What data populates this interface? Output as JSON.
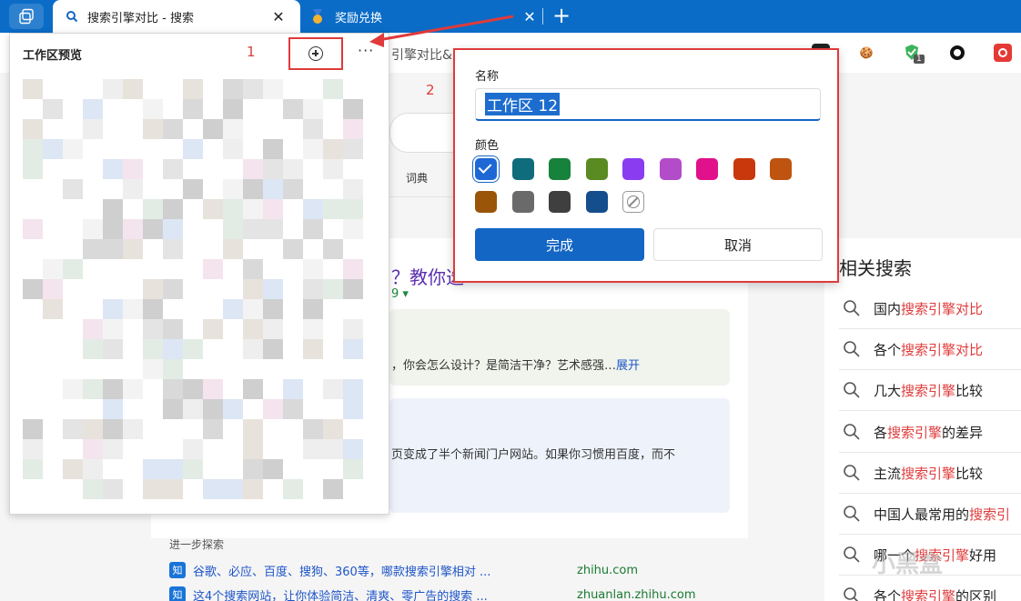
{
  "tabs": [
    {
      "title": "搜索引擎对比 - 搜索",
      "close": "✕",
      "active": true
    },
    {
      "title": "奖励兑换",
      "close": "✕",
      "active": false
    }
  ],
  "new_tab": "+",
  "toolbar": {
    "address_fragment": "引擎对比&"
  },
  "extensions": [
    {
      "name": "cookie-icon",
      "glyph": "🍪"
    },
    {
      "name": "shield-extension-icon",
      "badge": "1"
    },
    {
      "name": "ring-icon",
      "glyph": "O"
    }
  ],
  "workspace_panel": {
    "title": "工作区预览",
    "annotation_1": "1",
    "annotation_2": "2",
    "more": "···"
  },
  "dialog": {
    "name_label": "名称",
    "name_value": "工作区 12",
    "color_label": "颜色",
    "colors": [
      "#1e68d6",
      "#0f6c7a",
      "#16823c",
      "#5a8a22",
      "#8a3cf0",
      "#b24cc9",
      "#e0118a",
      "#c8380c",
      "#bf5410",
      "#9a5508",
      "#6a6a6a",
      "#3f3f3f",
      "#154e8c"
    ],
    "selected_color_index": 0,
    "done_label": "完成",
    "cancel_label": "取消"
  },
  "page": {
    "dict_tab": "词典",
    "result_title_fragment": "？教你选",
    "result_num_fragment": "9 ▾",
    "snippet1": "，你会怎么设计？是简洁干净？艺术感强…",
    "snippet1_more": "展开",
    "snippet2": "页变成了半个新闻门户网站。如果你习惯用百度，而不",
    "explore_label": "进一步探索",
    "explore_items": [
      {
        "badge": "知",
        "text": "谷歌、必应、百度、搜狗、360等，哪款搜索引擎相对 ...",
        "domain": "zhihu.com"
      },
      {
        "badge": "知",
        "text": "这4个搜索网站，让你体验简洁、清爽、零广告的搜索 ...",
        "domain": "zhuanlan.zhihu.com"
      }
    ]
  },
  "related": {
    "title": "相关搜索",
    "items": [
      {
        "prefix": "国内",
        "highlight": "搜索引擎对比",
        "suffix": ""
      },
      {
        "prefix": "各个",
        "highlight": "搜索引擎对比",
        "suffix": ""
      },
      {
        "prefix": "几大",
        "highlight": "搜索引擎",
        "suffix": "比较"
      },
      {
        "prefix": "各",
        "highlight": "搜索引擎",
        "suffix": "的差异"
      },
      {
        "prefix": "主流",
        "highlight": "搜索引擎",
        "suffix": "比较"
      },
      {
        "prefix": "中国人最常用的",
        "highlight": "搜索引",
        "suffix": ""
      },
      {
        "prefix": "哪一个",
        "highlight": "搜索引擎",
        "suffix": "好用"
      },
      {
        "prefix": "各个",
        "highlight": "搜索引擎",
        "suffix": "的区别"
      }
    ]
  },
  "watermark": "小黑盒"
}
